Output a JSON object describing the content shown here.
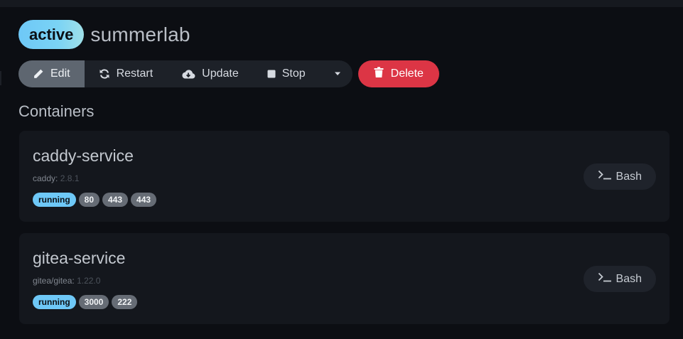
{
  "project": {
    "status": "active",
    "name": "summerlab"
  },
  "toolbar": {
    "edit": "Edit",
    "restart": "Restart",
    "update": "Update",
    "stop": "Stop",
    "delete": "Delete"
  },
  "containers_title": "Containers",
  "containers": [
    {
      "name": "caddy-service",
      "image": "caddy:",
      "version": "2.8.1",
      "state": "running",
      "ports": [
        "80",
        "443",
        "443"
      ],
      "action": "Bash"
    },
    {
      "name": "gitea-service",
      "image": "gitea/gitea:",
      "version": "1.22.0",
      "state": "running",
      "ports": [
        "3000",
        "222"
      ],
      "action": "Bash"
    }
  ],
  "colors": {
    "accent": "#6ec8f7",
    "danger": "#dc3545",
    "background": "#0c0e13",
    "card": "#14171d"
  },
  "icons": {
    "edit": "pencil-icon",
    "restart": "refresh-icon",
    "update": "cloud-download-icon",
    "stop": "stop-square-icon",
    "more": "caret-down-icon",
    "delete": "trash-icon",
    "bash": "terminal-icon"
  }
}
